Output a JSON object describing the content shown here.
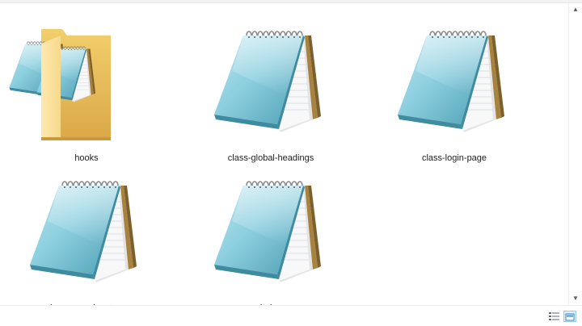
{
  "files": [
    {
      "name": "hooks",
      "type": "folder",
      "icon": "folder-icon"
    },
    {
      "name": "class-global-headings",
      "type": "text-file",
      "icon": "notepad-file-icon"
    },
    {
      "name": "class-login-page",
      "type": "text-file",
      "icon": "notepad-file-icon"
    },
    {
      "name": "class-svg-mime-type",
      "type": "text-file",
      "icon": "notepad-file-icon"
    },
    {
      "name": "index",
      "type": "text-file",
      "icon": "notepad-file-icon"
    }
  ],
  "view_mode": "large-icons",
  "colors": {
    "folder_back": "#e9c35e",
    "folder_front": "#fbe3a0",
    "notepad_blue": "#7cc5d6",
    "notepad_cover_dark": "#4a9fb5",
    "notepad_page": "#f7f7f7",
    "selected_view": "#dcefff"
  }
}
